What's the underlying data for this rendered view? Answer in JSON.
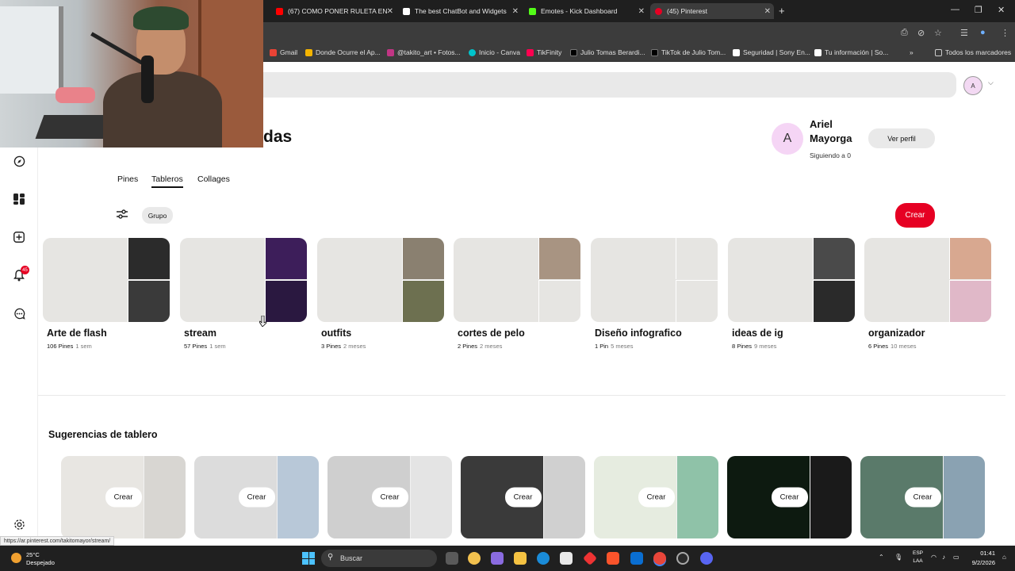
{
  "browser": {
    "tabs": [
      {
        "title": "(67) COMO PONER RULETA EN",
        "color": "#ff0000"
      },
      {
        "title": "The best ChatBot and Widgets",
        "color": "#ffffff"
      },
      {
        "title": "Emotes - Kick Dashboard",
        "color": "#53fc18"
      },
      {
        "title": "(45) Pinterest",
        "color": "#e60023"
      }
    ],
    "new_tab": "+",
    "bookmarks": [
      {
        "label": "Gmail",
        "color": "#ea4335"
      },
      {
        "label": "Donde Ocurre el Ap...",
        "color": "#f4b400"
      },
      {
        "label": "@takito_art • Fotos...",
        "color": "#c13584"
      },
      {
        "label": "Inicio - Canva",
        "color": "#00c4cc"
      },
      {
        "label": "TikFinity",
        "color": "#ff0050"
      },
      {
        "label": "Julio Tomas Berardi...",
        "color": "#000000"
      },
      {
        "label": "TikTok de Julio Tom...",
        "color": "#000000"
      },
      {
        "label": "Seguridad | Sony En...",
        "color": "#ffffff"
      },
      {
        "label": "Tu información | So...",
        "color": "#ffffff"
      }
    ],
    "bookmarks_overflow": "»",
    "all_bookmarks": "Todos los marcadores"
  },
  "header": {
    "avatar_letter": "A",
    "title_fragment": "das"
  },
  "profile": {
    "avatar_letter": "A",
    "name": "Ariel Mayorga",
    "following": "Siguiendo a 0",
    "view_profile": "Ver perfil"
  },
  "tabs": [
    "Pines",
    "Tableros",
    "Collages"
  ],
  "active_tab": "Tableros",
  "controls": {
    "group_chip": "Grupo",
    "create_button": "Crear"
  },
  "boards": [
    {
      "name": "Arte de flash",
      "pins": "106 Pines",
      "age": "1 sem",
      "thumbs": [
        "#2b2b2b",
        "#3a3a3a"
      ]
    },
    {
      "name": "stream",
      "pins": "57 Pines",
      "age": "1 sem",
      "thumbs": [
        "#3d1e5a",
        "#2a1840"
      ]
    },
    {
      "name": "outfits",
      "pins": "3 Pines",
      "age": "2 meses",
      "thumbs": [
        "#8a8070",
        "#6d7050"
      ]
    },
    {
      "name": "cortes de pelo",
      "pins": "2 Pines",
      "age": "2 meses",
      "thumbs": [
        "#a89482",
        "#e6e5e2"
      ]
    },
    {
      "name": "Diseño infografico",
      "pins": "1 Pin",
      "age": "5 meses",
      "thumbs": [
        "#e6e5e2",
        "#e6e5e2"
      ]
    },
    {
      "name": "ideas de ig",
      "pins": "8 Pines",
      "age": "9 meses",
      "thumbs": [
        "#4a4a4a",
        "#2a2a2a"
      ]
    },
    {
      "name": "organizador",
      "pins": "6 Pines",
      "age": "10 meses",
      "thumbs": [
        "#d8a890",
        "#e0b8c8"
      ]
    }
  ],
  "suggestions": {
    "title": "Sugerencias de tablero",
    "button_label": "Crear",
    "cards": [
      {
        "left": "#e8e6e2",
        "right": "#d8d6d2"
      },
      {
        "left": "#dcdcdc",
        "right": "#b8c8d8"
      },
      {
        "left": "#cfcfcf",
        "right": "#e4e4e4"
      },
      {
        "left": "#3a3a3a",
        "right": "#d0d0d0"
      },
      {
        "left": "#e6ece0",
        "right": "#8fc2a8"
      },
      {
        "left": "#0d1a10",
        "right": "#1a1a1a"
      },
      {
        "left": "#5a7a6a",
        "right": "#8aa2b2"
      }
    ]
  },
  "status_url": "https://ar.pinterest.com/takitomayor/stream/",
  "taskbar": {
    "temperature": "25°C",
    "weather": "Despejado",
    "search_placeholder": "Buscar",
    "language": "ESP",
    "language_sub": "LAA",
    "time": "01:41",
    "date": "9/2/2026"
  }
}
